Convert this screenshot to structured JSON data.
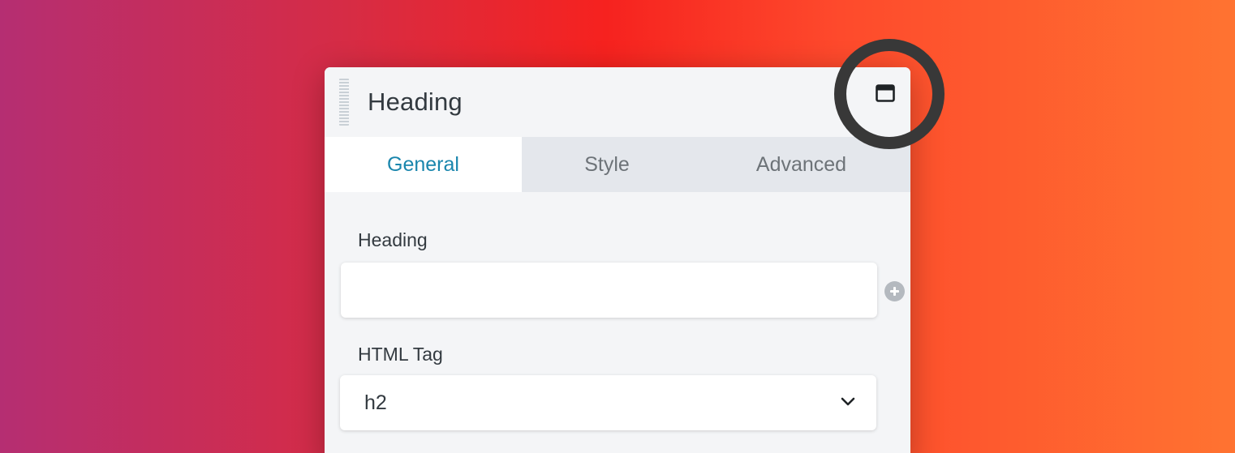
{
  "panel": {
    "title": "Heading",
    "icons": {
      "drag_handle": "drag-handle-icon",
      "window": "window-maximize-icon"
    }
  },
  "tabs": [
    {
      "label": "General",
      "active": true
    },
    {
      "label": "Style",
      "active": false
    },
    {
      "label": "Advanced",
      "active": false
    }
  ],
  "fields": {
    "heading": {
      "label": "Heading",
      "value": "",
      "action_icon": "plus-circle-icon"
    },
    "html_tag": {
      "label": "HTML Tag",
      "selected": "h2",
      "icon": "chevron-down-icon"
    }
  },
  "colors": {
    "accent": "#1a86ad",
    "panel_bg": "#f4f5f7",
    "tab_bar_bg": "#e4e7ec",
    "highlight_ring": "#383838",
    "background_gradient": [
      "#b52e72",
      "#f6221f",
      "#ff7331"
    ]
  }
}
